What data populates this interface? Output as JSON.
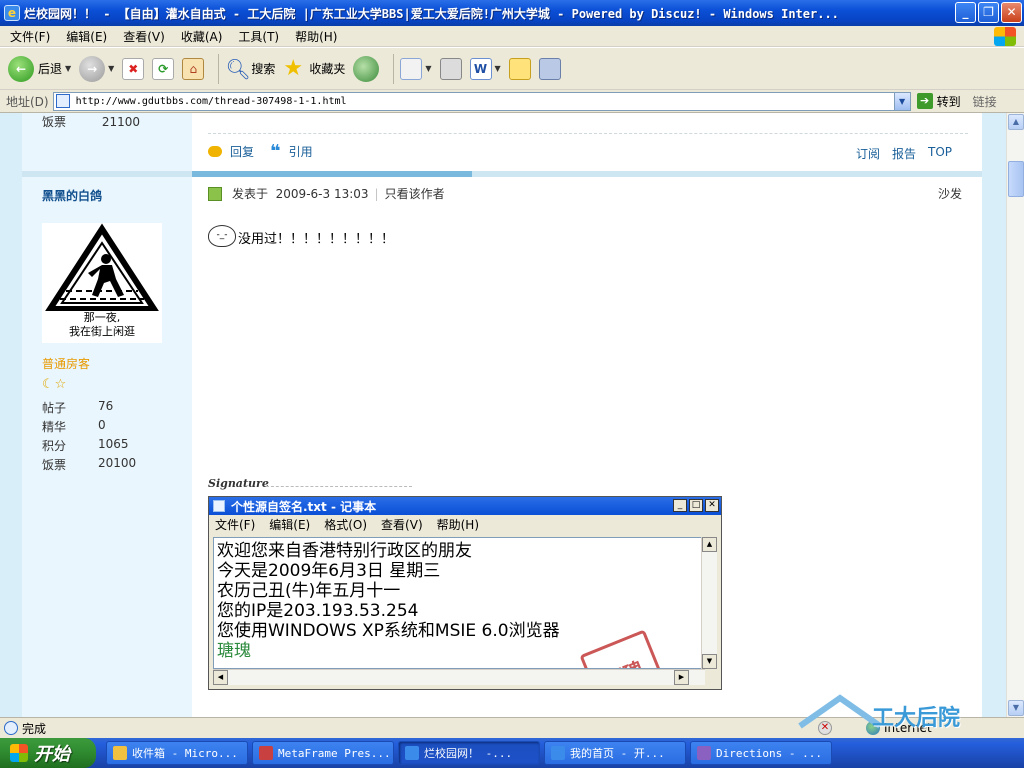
{
  "window": {
    "title": "烂校园网！！ - 【自由】灌水自由式 - 工大后院 |广东工业大学BBS|爱工大爱后院!广州大学城 - Powered by Discuz! - Windows Inter...",
    "controls": {
      "minimize": "_",
      "maximize": "❐",
      "close": "✕"
    }
  },
  "menu": [
    "文件(F)",
    "编辑(E)",
    "查看(V)",
    "收藏(A)",
    "工具(T)",
    "帮助(H)"
  ],
  "toolbar": {
    "back": "后退",
    "search": "搜索",
    "favorites": "收藏夹"
  },
  "address": {
    "label": "地址(D)",
    "url": "http://www.gdutbbs.com/thread-307498-1-1.html",
    "go": "转到",
    "links": "链接"
  },
  "prev_post": {
    "stat_label": "饭票",
    "stat_value": "21100",
    "actions": {
      "reply": "回复",
      "quote": "引用"
    },
    "right_links": [
      "订阅",
      "报告",
      "TOP"
    ]
  },
  "user": {
    "name": "黑黑的白鸽",
    "avatar_caption_line1": "那一夜,",
    "avatar_caption_line2": "我在街上闲逛",
    "rank": "普通房客",
    "stats": [
      {
        "k": "帖子",
        "v": "76"
      },
      {
        "k": "精华",
        "v": "0"
      },
      {
        "k": "积分",
        "v": "1065"
      },
      {
        "k": "饭票",
        "v": "20100"
      }
    ]
  },
  "post": {
    "posted_label": "发表于",
    "posted_time": "2009-6-3 13:03",
    "only_author": "只看该作者",
    "floor": "沙发",
    "message": "没用过！！！！！！！！！"
  },
  "signature": {
    "label": "Signature",
    "notepad_title": "个性源自签名.txt - 记事本",
    "notepad_menu": [
      "文件(F)",
      "编辑(E)",
      "格式(O)",
      "查看(V)",
      "帮助(H)"
    ],
    "lines": [
      "欢迎您来自香港特别行政区的朋友",
      "今天是2009年6月3日 星期三",
      "农历己丑(牛)年五月十一",
      "您的IP是203.193.53.254",
      "您使用WINDOWS XP系统和MSIE 6.0浏览器"
    ],
    "sign_name": "瑭瑰",
    "seal_text": "印瑰"
  },
  "status": {
    "text": "完成",
    "zone": "Internet"
  },
  "watermark": {
    "text": "工大后院"
  },
  "taskbar": {
    "start": "开始",
    "tasks": [
      {
        "label": "收件箱 - Micro...",
        "color": "#f0c040"
      },
      {
        "label": "MetaFrame Pres...",
        "color": "#c84040"
      },
      {
        "label": "烂校园网！ -...",
        "color": "#3a8bea"
      },
      {
        "label": "我的首页 - 开...",
        "color": "#3a8bea"
      },
      {
        "label": "Directions - ...",
        "color": "#8a60c0"
      }
    ]
  }
}
